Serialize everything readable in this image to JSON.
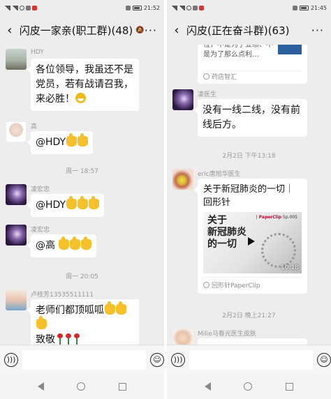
{
  "left": {
    "status": {
      "time": "21:52"
    },
    "title": "闪皮一家亲(职工群)(48)",
    "messages": [
      {
        "sender": "HDY",
        "text": "各位领导，我虽还不是党员，若有战请召我，来必胜！"
      },
      {
        "sender": "高",
        "text": "@HDY"
      },
      {
        "time": "周一 18:57"
      },
      {
        "sender": "凌宏忠",
        "text": "@HDY"
      },
      {
        "sender": "凌宏忠",
        "text": "@高"
      },
      {
        "time": "周一 20:05"
      },
      {
        "sender": "卢桂芳13535511111",
        "text": "老师们都顶呱呱",
        "text2": "致敬"
      }
    ]
  },
  "right": {
    "status": {
      "time": "21:45"
    },
    "title": "闪皮(正在奋斗群)(63)",
    "top_card": {
      "text": "位，不是为了业绩、不是为了那么点利…",
      "source": "药店智汇"
    },
    "messages": [
      {
        "sender": "凌医生",
        "text": "没有一线二线，没有前线后方。"
      },
      {
        "time": "2月2日 下午13:18"
      },
      {
        "sender": "eric唐旭华医生",
        "card_title": "关于新冠肺炎的一切｜回形针",
        "thumb_big": "关于\n新冠肺炎\n的一切",
        "thumb_tag_brand": "PaperClip",
        "thumb_tag_ep": "5p.005",
        "duration": "10:18",
        "source": "回形针PaperClip"
      },
      {
        "time": "2月2日 晚上21:27"
      },
      {
        "sender": "Milie马春光医生皮肤"
      }
    ]
  },
  "colors": {
    "background": "#ededed",
    "bubble": "#ffffff",
    "meta_text": "#999999"
  }
}
